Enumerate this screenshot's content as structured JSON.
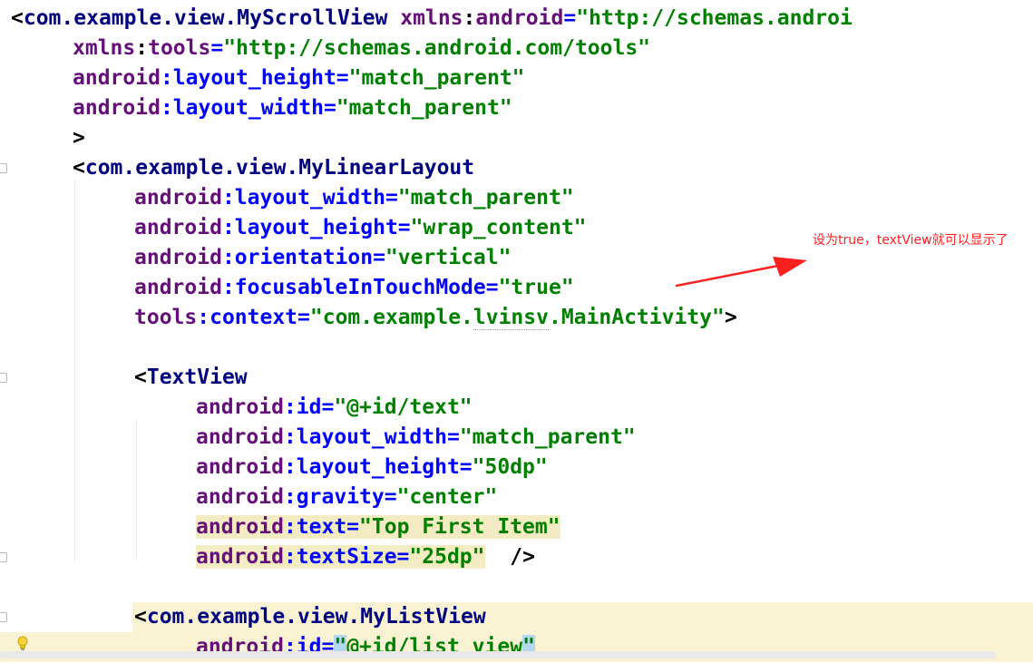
{
  "editor": {
    "lines": [
      {
        "indent": 0,
        "tokens": [
          {
            "k": "punct",
            "t": "<"
          },
          {
            "k": "tag",
            "t": "com.example.view.MyScrollView"
          },
          {
            "k": "plain",
            "t": " "
          },
          {
            "k": "ns",
            "t": "xmlns"
          },
          {
            "k": "punct",
            "t": ":"
          },
          {
            "k": "ns",
            "t": "android"
          },
          {
            "k": "attr",
            "t": "="
          },
          {
            "k": "val",
            "t": "\"http://schemas.androi"
          }
        ]
      },
      {
        "indent": 1,
        "tokens": [
          {
            "k": "ns",
            "t": "xmlns"
          },
          {
            "k": "punct",
            "t": ":"
          },
          {
            "k": "ns",
            "t": "tools"
          },
          {
            "k": "attr",
            "t": "="
          },
          {
            "k": "val",
            "t": "\"http://schemas.android.com/tools\""
          }
        ]
      },
      {
        "indent": 1,
        "tokens": [
          {
            "k": "ns",
            "t": "android"
          },
          {
            "k": "attr",
            "t": ":layout_height="
          },
          {
            "k": "val",
            "t": "\"match_parent\""
          }
        ]
      },
      {
        "indent": 1,
        "tokens": [
          {
            "k": "ns",
            "t": "android"
          },
          {
            "k": "attr",
            "t": ":layout_width="
          },
          {
            "k": "val",
            "t": "\"match_parent\""
          }
        ]
      },
      {
        "indent": 1,
        "tokens": [
          {
            "k": "punct",
            "t": ">"
          }
        ]
      },
      {
        "indent": 1,
        "fold": true,
        "tokens": [
          {
            "k": "punct",
            "t": "<"
          },
          {
            "k": "tag",
            "t": "com.example.view.MyLinearLayout"
          }
        ]
      },
      {
        "indent": 2,
        "tokens": [
          {
            "k": "ns",
            "t": "android"
          },
          {
            "k": "attr",
            "t": ":layout_width="
          },
          {
            "k": "val",
            "t": "\"match_parent\""
          }
        ]
      },
      {
        "indent": 2,
        "tokens": [
          {
            "k": "ns",
            "t": "android"
          },
          {
            "k": "attr",
            "t": ":layout_height="
          },
          {
            "k": "val",
            "t": "\"wrap_content\""
          }
        ]
      },
      {
        "indent": 2,
        "tokens": [
          {
            "k": "ns",
            "t": "android"
          },
          {
            "k": "attr",
            "t": ":orientation="
          },
          {
            "k": "val",
            "t": "\"vertical\""
          }
        ]
      },
      {
        "indent": 2,
        "tokens": [
          {
            "k": "ns",
            "t": "android"
          },
          {
            "k": "attr",
            "t": ":focusableInTouchMode="
          },
          {
            "k": "val",
            "t": "\"true\""
          }
        ]
      },
      {
        "indent": 2,
        "tokens": [
          {
            "k": "ns",
            "t": "tools"
          },
          {
            "k": "attr",
            "t": ":context="
          },
          {
            "k": "val",
            "t": "\"com.example."
          },
          {
            "k": "val",
            "t": "lvinsv",
            "squiggle": true
          },
          {
            "k": "val",
            "t": ".MainActivity\""
          },
          {
            "k": "punct",
            "t": ">"
          }
        ]
      },
      {
        "indent": 0,
        "tokens": []
      },
      {
        "indent": 2,
        "fold": true,
        "tokens": [
          {
            "k": "punct",
            "t": "<"
          },
          {
            "k": "tag",
            "t": "TextView"
          }
        ]
      },
      {
        "indent": 3,
        "tokens": [
          {
            "k": "ns",
            "t": "android"
          },
          {
            "k": "attr",
            "t": ":id="
          },
          {
            "k": "val",
            "t": "\"@+id/text\""
          }
        ]
      },
      {
        "indent": 3,
        "tokens": [
          {
            "k": "ns",
            "t": "android"
          },
          {
            "k": "attr",
            "t": ":layout_width="
          },
          {
            "k": "val",
            "t": "\"match_parent\""
          }
        ]
      },
      {
        "indent": 3,
        "tokens": [
          {
            "k": "ns",
            "t": "android"
          },
          {
            "k": "attr",
            "t": ":layout_height="
          },
          {
            "k": "val",
            "t": "\"50dp\""
          }
        ]
      },
      {
        "indent": 3,
        "tokens": [
          {
            "k": "ns",
            "t": "android"
          },
          {
            "k": "attr",
            "t": ":gravity="
          },
          {
            "k": "val",
            "t": "\"center\""
          }
        ]
      },
      {
        "indent": 3,
        "spanHl": true,
        "tokens": [
          {
            "k": "ns",
            "t": "android"
          },
          {
            "k": "attr",
            "t": ":text="
          },
          {
            "k": "val",
            "t": "\"Top First Item\""
          }
        ]
      },
      {
        "indent": 3,
        "spanHl": true,
        "fold": true,
        "tokens": [
          {
            "k": "ns",
            "t": "android"
          },
          {
            "k": "attr",
            "t": ":textSize="
          },
          {
            "k": "val",
            "t": "\"25dp\""
          },
          {
            "k": "plain",
            "t": " ",
            "nohl": true
          },
          {
            "k": "punct",
            "t": " />",
            "nohl": true
          }
        ]
      },
      {
        "indent": 0,
        "tokens": []
      },
      {
        "indent": 2,
        "lineHl": true,
        "fold": true,
        "tokens": [
          {
            "k": "punct",
            "t": "<"
          },
          {
            "k": "tag",
            "t": "com.example.view.MyListView"
          }
        ]
      },
      {
        "indent": 3,
        "lineHl": true,
        "caretLine": true,
        "tokens": [
          {
            "k": "ns",
            "t": "android"
          },
          {
            "k": "attr",
            "t": ":id="
          },
          {
            "k": "val",
            "t": "\"",
            "match": true
          },
          {
            "k": "val",
            "t": "@+id/list_view"
          },
          {
            "k": "val",
            "t": "\"",
            "match": true
          }
        ]
      }
    ]
  },
  "annotation": {
    "text": "设为true，textView就可以显示了",
    "color": "#ff2020"
  },
  "icons": {
    "fold": "fold-marker-icon",
    "intention": "lightbulb-icon"
  },
  "colors": {
    "tag": "#000080",
    "namespace": "#660e7a",
    "attribute": "#0000ff",
    "value": "#008000",
    "line_highlight": "#faf3d3",
    "brace_match": "#b4d7f0"
  }
}
